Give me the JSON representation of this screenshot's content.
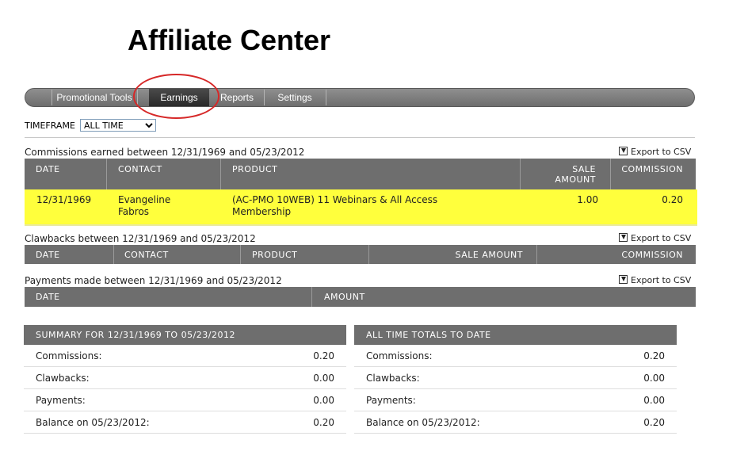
{
  "page": {
    "title": "Affiliate Center"
  },
  "nav": {
    "tabs": [
      {
        "label": "Promotional Tools"
      },
      {
        "label": "Earnings"
      },
      {
        "label": "Reports"
      },
      {
        "label": "Settings"
      }
    ],
    "active_tab": "Earnings"
  },
  "timeframe": {
    "label": "TIMEFRAME",
    "selected": "ALL TIME"
  },
  "export_label": "Export to CSV",
  "commissions": {
    "label": "Commissions earned between 12/31/1969 and 05/23/2012",
    "columns": [
      "DATE",
      "CONTACT",
      "PRODUCT",
      "SALE\nAMOUNT",
      "COMMISSION"
    ],
    "rows": [
      {
        "date": "12/31/1969",
        "contact_line1": "Evangeline",
        "contact_line2": "Fabros",
        "product_line1": "(AC-PMO 10WEB) 11 Webinars & All Access",
        "product_line2": "Membership",
        "sale_amount": "1.00",
        "commission": "0.20"
      }
    ]
  },
  "clawbacks": {
    "label": "Clawbacks between 12/31/1969 and 05/23/2012",
    "columns": [
      "DATE",
      "CONTACT",
      "PRODUCT",
      "SALE AMOUNT",
      "COMMISSION"
    ]
  },
  "payments": {
    "label": "Payments made between 12/31/1969 and 05/23/2012",
    "columns": [
      "DATE",
      "AMOUNT"
    ]
  },
  "summary": {
    "title": "SUMMARY FOR 12/31/1969 TO 05/23/2012",
    "rows": [
      {
        "label": "Commissions:",
        "value": "0.20"
      },
      {
        "label": "Clawbacks:",
        "value": "0.00"
      },
      {
        "label": "Payments:",
        "value": "0.00"
      },
      {
        "label": "Balance on 05/23/2012:",
        "value": "0.20"
      }
    ]
  },
  "totals": {
    "title": "ALL TIME TOTALS TO DATE",
    "rows": [
      {
        "label": "Commissions:",
        "value": "0.20"
      },
      {
        "label": "Clawbacks:",
        "value": "0.00"
      },
      {
        "label": "Payments:",
        "value": "0.00"
      },
      {
        "label": "Balance on 05/23/2012:",
        "value": "0.20"
      }
    ]
  },
  "colors": {
    "header_gray": "#6e6e6e",
    "highlight_row": "#ffff3c",
    "annotation_ring": "#d62828"
  }
}
